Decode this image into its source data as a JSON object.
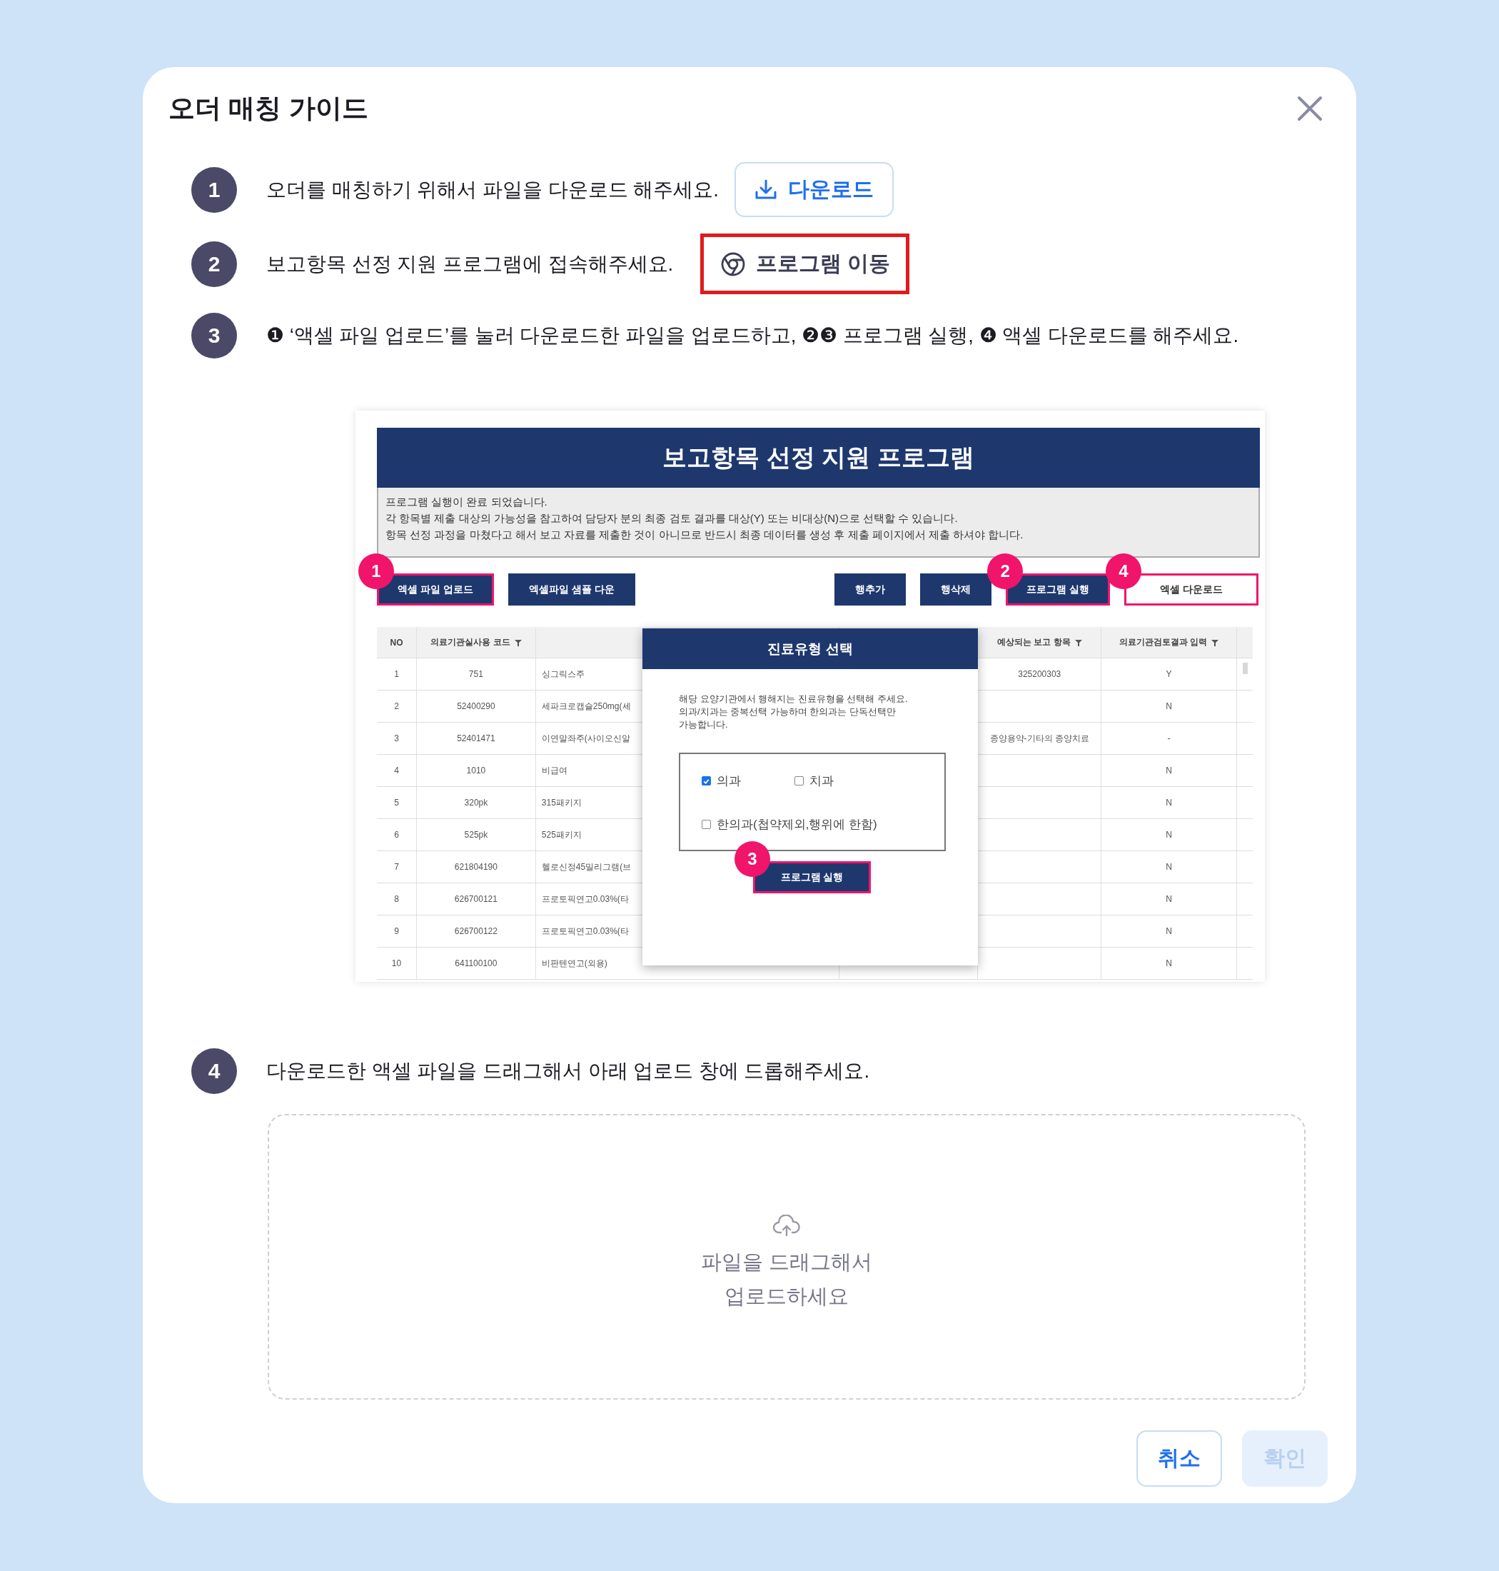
{
  "dialog": {
    "title": "오더 매칭 가이드"
  },
  "steps": [
    {
      "number": "1",
      "text": "오더를 매칭하기 위해서 파일을 다운로드 해주세요.",
      "kind": "download",
      "button": {
        "label": "다운로드",
        "highlighted": false
      }
    },
    {
      "number": "2",
      "text": "보고항목 선정 지원 프로그램에 접속해주세요.",
      "kind": "program",
      "button": {
        "label": "프로그램 이동",
        "highlighted": true
      }
    },
    {
      "number": "3",
      "text": "❶ ‘액셀 파일 업로드’를 눌러 다운로드한 파일을 업로드하고, ❷❸ 프로그램 실행, ❹ 액셀 다운로드를 해주세요.",
      "kind": "text"
    }
  ],
  "screenshot": {
    "title": "보고항목 선정 지원 프로그램",
    "notice": [
      "프로그램 실행이 완료 되었습니다.",
      "각 항목별 제출 대상의 가능성을 참고하여 담당자 분의 최종 검토 결과를 대상(Y) 또는 비대상(N)으로 선택할 수 있습니다.",
      "항목 선정 과정을 마쳤다고 해서 보고 자료를 제출한 것이 아니므로 반드시 최종 데이터를 생성 후 제출 페이지에서 제출 하셔야 합니다."
    ],
    "left_buttons": [
      {
        "label": "엑셀 파일 업로드",
        "highlighted": true,
        "marker": "1",
        "kind": "filled"
      },
      {
        "label": "엑셀파일 샘플 다운",
        "highlighted": false,
        "kind": "filled"
      }
    ],
    "right_buttons": [
      {
        "label": "행추가",
        "highlighted": false,
        "kind": "filled"
      },
      {
        "label": "행삭제",
        "highlighted": false,
        "kind": "filled"
      },
      {
        "label": "프로그램 실행",
        "highlighted": true,
        "marker": "2",
        "kind": "filled"
      },
      {
        "label": "엑셀 다운로드",
        "highlighted": true,
        "marker": "4",
        "kind": "outline"
      }
    ],
    "columns": [
      {
        "label": "NO",
        "filter": false
      },
      {
        "label": "의료기관실사용 코드",
        "filter": true
      },
      {
        "label": "예상되는 보고 항목",
        "filter": true
      },
      {
        "label": "의료기관검토결과 입력",
        "filter": true
      }
    ],
    "rows": [
      {
        "no": "1",
        "code": "751",
        "name": "싱그릭스주",
        "expected": "325200303",
        "review": "Y"
      },
      {
        "no": "2",
        "code": "52400290",
        "name": "세파크로캡슐250mg(세",
        "review": "N"
      },
      {
        "no": "3",
        "code": "52401471",
        "name": "이연말좌주(사이오신알",
        "expected": "종양용약-기타의 종양치료",
        "review": "-"
      },
      {
        "no": "4",
        "code": "1010",
        "name": "비급여",
        "review": "N"
      },
      {
        "no": "5",
        "code": "320pk",
        "name": "315패키지",
        "review": "N"
      },
      {
        "no": "6",
        "code": "525pk",
        "name": "525패키지",
        "review": "N"
      },
      {
        "no": "7",
        "code": "621804190",
        "name": "헬로신정45밀리그램(브",
        "review": "N"
      },
      {
        "no": "8",
        "code": "626700121",
        "name": "프로토픽연고0.03%(타",
        "review": "N"
      },
      {
        "no": "9",
        "code": "626700122",
        "name": "프로토픽연고0.03%(타",
        "review": "N"
      },
      {
        "no": "10",
        "code": "641100100",
        "name": "비판텐연고(외용)",
        "review": "N"
      }
    ],
    "popup": {
      "title": "진료유형 선택",
      "description": "해당 요양기관에서 행해지는 진료유형을 선택해 주세요.\n의과/치과는 중복선택 가능하며 한의과는 단독선택만\n가능합니다.",
      "options": [
        {
          "label": "의과",
          "checked": true
        },
        {
          "label": "치과",
          "checked": false
        },
        {
          "label": "한의과(첩약제외,행위에 한함)",
          "checked": false
        }
      ],
      "button": {
        "label": "프로그램 실행",
        "highlighted": true,
        "marker": "3"
      }
    }
  },
  "step4": {
    "number": "4",
    "text": "다운로드한 액셀 파일을 드래그해서 아래 업로드 창에 드롭해주세요."
  },
  "dropzone": {
    "text": "파일을 드래그해서\n업로드하세요"
  },
  "footer": [
    {
      "label": "취소",
      "disabled": false
    },
    {
      "label": "확인",
      "disabled": true
    }
  ]
}
